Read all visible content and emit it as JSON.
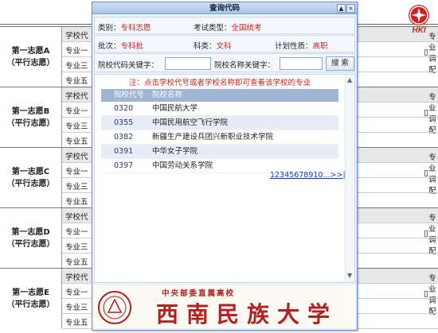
{
  "background": {
    "groups": [
      {
        "line1": "第一志愿A",
        "line2": "（平行志愿）",
        "rows": [
          "学校代",
          "专业一",
          "专业三",
          "专业五"
        ]
      },
      {
        "line1": "第一志愿B",
        "line2": "（平行志愿）",
        "rows": [
          "学校代",
          "专业一",
          "专业三",
          "专业五"
        ]
      },
      {
        "line1": "第一志愿C",
        "line2": "（平行志愿）",
        "rows": [
          "学校代",
          "专业一",
          "专业三",
          "专业五"
        ]
      },
      {
        "line1": "第一志愿D",
        "line2": "（平行志愿）",
        "rows": [
          "学校代",
          "专业一",
          "专业三",
          "专业五"
        ]
      },
      {
        "line1": "第一志愿E",
        "line2": "（平行志愿）",
        "rows": [
          "学校代",
          "专业一",
          "专业三",
          "专业五"
        ]
      }
    ],
    "adjust_label": "专业调配"
  },
  "logo": {
    "text": "HKI",
    "color": "#d81e1e"
  },
  "dialog": {
    "title": "查询代码",
    "minimize_glyph": "▲",
    "close_glyph": "×",
    "category_label": "类别：",
    "category_value": "专科志愿",
    "exam_type_label": "考试类型：",
    "exam_type_value": "全国统考",
    "batch_label": "批次：",
    "batch_value": "专科批",
    "subject_label": "科类：",
    "subject_value": "文科",
    "plan_label": "计划性质：",
    "plan_value": "高职",
    "code_keyword_label": "院校代码关键字：",
    "name_keyword_label": "院校名称关键字：",
    "code_keyword_value": "",
    "name_keyword_value": "",
    "search_button": "搜 索",
    "note": "注：点击学校代号或者学校名称即可查看该学校的专业",
    "table": {
      "headers": [
        "院校代号",
        "院校名称"
      ],
      "rows": [
        {
          "code": "0320",
          "name": "中国民航大学"
        },
        {
          "code": "0355",
          "name": "中国民用航空飞行学院"
        },
        {
          "code": "0382",
          "name": "新疆生产建设兵团兴新职业技术学院"
        },
        {
          "code": "0391",
          "name": "中华女子学院"
        },
        {
          "code": "0397",
          "name": "中国劳动关系学院"
        }
      ]
    },
    "pager": "12345678910...>>|",
    "banner_subtitle": "中央部委直属高校",
    "banner_title": "西南民族大学",
    "accent_color": "#c0282b"
  }
}
